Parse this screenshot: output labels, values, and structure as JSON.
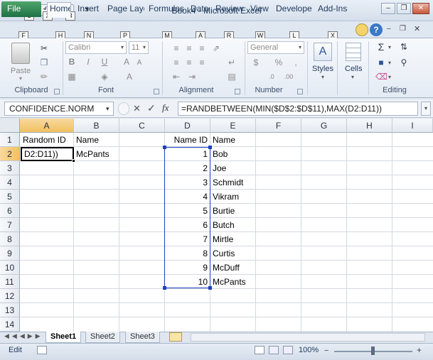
{
  "window": {
    "title": "Book4 - Microsoft Excel",
    "app_icon": "X",
    "minimize_icon": "minimize-icon",
    "restore_icon": "restore-icon",
    "close_icon": "close-icon"
  },
  "qat": {
    "keytips": [
      "1",
      "2",
      "3"
    ]
  },
  "ribbon_tabs": [
    {
      "label": "File",
      "keytip": "F"
    },
    {
      "label": "Home",
      "keytip": "H"
    },
    {
      "label": "Insert",
      "keytip": "N"
    },
    {
      "label": "Page Layc",
      "keytip": "P"
    },
    {
      "label": "Formulas",
      "keytip": "M"
    },
    {
      "label": "Data",
      "keytip": "A"
    },
    {
      "label": "Review",
      "keytip": "R"
    },
    {
      "label": "View",
      "keytip": "W"
    },
    {
      "label": "Develope",
      "keytip": "L"
    },
    {
      "label": "Add-Ins",
      "keytip": "X"
    }
  ],
  "ribbon": {
    "clipboard": {
      "label": "Clipboard",
      "paste_label": "Paste"
    },
    "font": {
      "label": "Font",
      "font_name": "Calibri",
      "font_size": "11"
    },
    "alignment": {
      "label": "Alignment"
    },
    "number": {
      "label": "Number",
      "format": "General"
    },
    "styles": {
      "label": "Styles"
    },
    "cells": {
      "label": "Cells"
    },
    "editing": {
      "label": "Editing"
    }
  },
  "formula_bar": {
    "name_box": "CONFIDENCE.NORM",
    "fx_label": "fx",
    "formula": "=RANDBETWEEN(MIN($D$2:$D$11),MAX(D2:D11))"
  },
  "grid": {
    "columns": [
      "A",
      "B",
      "C",
      "D",
      "E",
      "F",
      "G",
      "H",
      "I"
    ],
    "rows": [
      "1",
      "2",
      "3",
      "4",
      "5",
      "6",
      "7",
      "8",
      "9",
      "10",
      "11",
      "12",
      "13",
      "14"
    ],
    "a1": "Random ID",
    "b1": "Name",
    "a2": "D2:D11))",
    "b2": "McPants",
    "d1": "Name ID",
    "e1": "Name",
    "ids": [
      "1",
      "2",
      "3",
      "4",
      "5",
      "6",
      "7",
      "8",
      "9",
      "10"
    ],
    "names": [
      "Bob",
      "Joe",
      "Schmidt",
      "Vikram",
      "Burtie",
      "Butch",
      "Mirtle",
      "Curtis",
      "McDuff",
      "McPants"
    ]
  },
  "sheets": [
    "Sheet1",
    "Sheet2",
    "Sheet3"
  ],
  "status": {
    "mode": "Edit",
    "zoom": "100%"
  },
  "colors": {
    "file_tab": "#1e7145",
    "selection_header": "#f1c15f",
    "range_border": "#1f3fbf"
  }
}
